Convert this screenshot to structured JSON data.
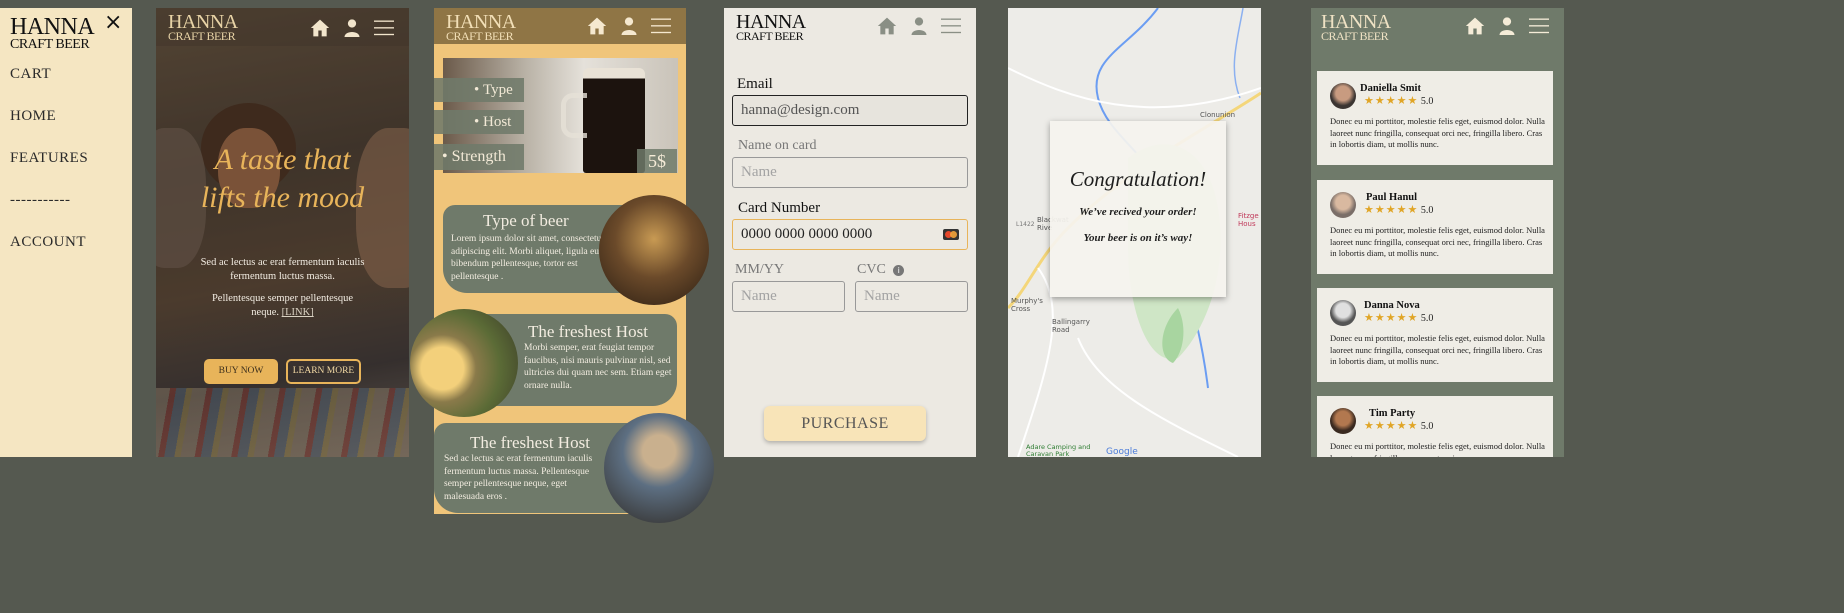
{
  "brand": {
    "line1": "HANNA",
    "line2": "CRAFT BEER"
  },
  "colors": {
    "bg": "#555950",
    "cream": "#f5e6c2",
    "gold": "#e8b45a",
    "header_brown": "#8f7545",
    "sage": "#6f7a6a",
    "panel": "#ece9e2"
  },
  "menu": {
    "items": [
      "CART",
      "HOME",
      "FEATURES",
      "-----------",
      "ACCOUNT"
    ],
    "close": "×"
  },
  "hero": {
    "headline_1": "A taste that",
    "headline_2": "lifts the mood",
    "p1": "Sed ac lectus ac erat fermentum iaculis fermentum luctus massa.",
    "p2a": "Pellentesque semper pellentesque neque. ",
    "link": "[LINK]",
    "buy": "BUY NOW",
    "learn": "LEARN MORE"
  },
  "features": {
    "bullets": [
      "Type",
      "Host",
      "Strength"
    ],
    "price": "5$",
    "cards": [
      {
        "title": "Type of beer",
        "text": "Lorem ipsum dolor sit amet, consectetur adipiscing elit. Morbi aliquet, ligula eu bibendum pellentesque, tortor est pellentesque ."
      },
      {
        "title": "The freshest Host",
        "text": "Morbi semper, erat feugiat tempor faucibus, nisi mauris pulvinar nisl, sed ultricies dui quam nec sem. Etiam eget ornare nulla."
      },
      {
        "title": "The freshest Host",
        "text": "Sed ac lectus ac erat fermentum iaculis fermentum luctus massa. Pellentesque semper pellentesque neque, eget malesuada eros ."
      }
    ]
  },
  "checkout": {
    "email_label": "Email",
    "email_value": "hanna@design.com",
    "name_label": "Name on card",
    "name_placeholder": "Name",
    "card_label": "Card Number",
    "card_value": "0000 0000 0000 0000",
    "mmyy_label": "MM/YY",
    "cvc_label": "CVC",
    "mm_placeholder": "Name",
    "cvc_placeholder": "Name",
    "purchase": "PURCHASE"
  },
  "confirm": {
    "title": "Congratulation!",
    "line1": "We’ve recived your order!",
    "line2": "Your beer is on it’s way!",
    "map_labels": [
      "Clonunion",
      "Fitzge Hous",
      "Blackwat Rive",
      "Murphy's Cross",
      "Ballingarry Road",
      "Adare Camping and Caravan Park",
      "L1422",
      "Google"
    ]
  },
  "reviews": {
    "items": [
      {
        "name": "Daniella Smit",
        "score": "5.0",
        "stars": "★★★★★",
        "text": "Donec eu mi porttitor, molestie felis eget, euismod dolor. Nulla laoreet nunc fringilla, consequat orci nec, fringilla libero. Cras in lobortis diam, ut mollis nunc."
      },
      {
        "name": "Paul Hanul",
        "score": "5.0",
        "stars": "★★★★★",
        "text": "Donec eu mi porttitor, molestie felis eget, euismod dolor. Nulla laoreet nunc fringilla, consequat orci nec, fringilla libero. Cras in lobortis diam, ut mollis nunc."
      },
      {
        "name": "Danna Nova",
        "score": "5.0",
        "stars": "★★★★★",
        "text": "Donec eu mi porttitor, molestie felis eget, euismod dolor. Nulla laoreet nunc fringilla, consequat orci nec, fringilla libero. Cras in lobortis diam, ut mollis nunc."
      },
      {
        "name": "Tim Party",
        "score": "5.0",
        "stars": "★★★★★",
        "text": "Donec eu mi porttitor, molestie felis eget, euismod dolor. Nulla laoreet nunc fringilla, consequat orci nec."
      }
    ]
  }
}
